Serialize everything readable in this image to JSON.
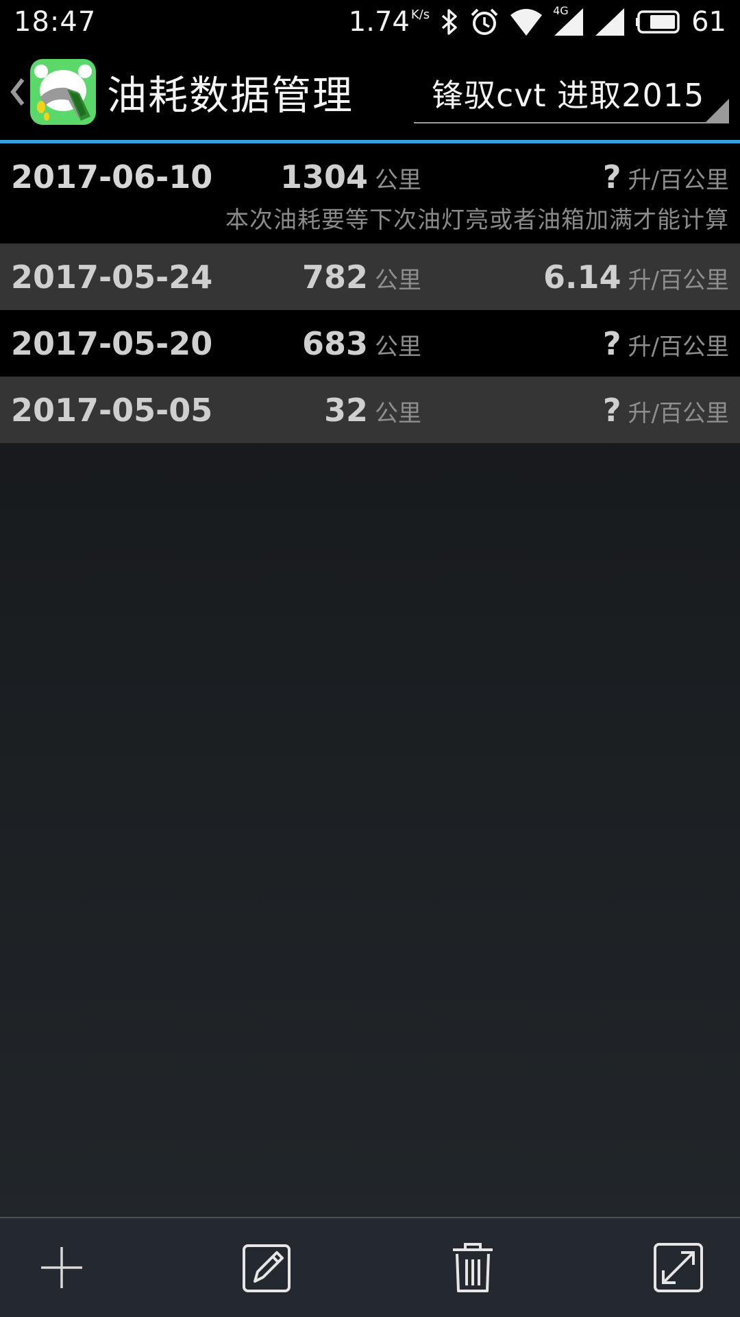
{
  "status_bar": {
    "time": "18:47",
    "net_speed": "1.74",
    "net_speed_unit": "K/s",
    "network_type": "4G",
    "battery_level": "61",
    "icons": [
      "bluetooth-icon",
      "alarm-icon",
      "wifi-icon",
      "signal-icon",
      "signal-icon",
      "battery-icon"
    ]
  },
  "action_bar": {
    "title": "油耗数据管理",
    "car_selector_value": "锋驭cvt 进取2015",
    "accent_color": "#33a4dd",
    "app_icon_color": "#5ad86a"
  },
  "records": [
    {
      "date": "2017-06-10",
      "distance": "1304",
      "distance_unit": "公里",
      "consumption": "?",
      "consumption_unit": "升/百公里",
      "note": "本次油耗要等下次油灯亮或者油箱加满才能计算"
    },
    {
      "date": "2017-05-24",
      "distance": "782",
      "distance_unit": "公里",
      "consumption": "6.14",
      "consumption_unit": "升/百公里"
    },
    {
      "date": "2017-05-20",
      "distance": "683",
      "distance_unit": "公里",
      "consumption": "?",
      "consumption_unit": "升/百公里"
    },
    {
      "date": "2017-05-05",
      "distance": "32",
      "distance_unit": "公里",
      "consumption": "?",
      "consumption_unit": "升/百公里"
    }
  ],
  "toolbar": {
    "icons": [
      "add-icon",
      "edit-icon",
      "delete-icon",
      "expand-icon"
    ]
  }
}
